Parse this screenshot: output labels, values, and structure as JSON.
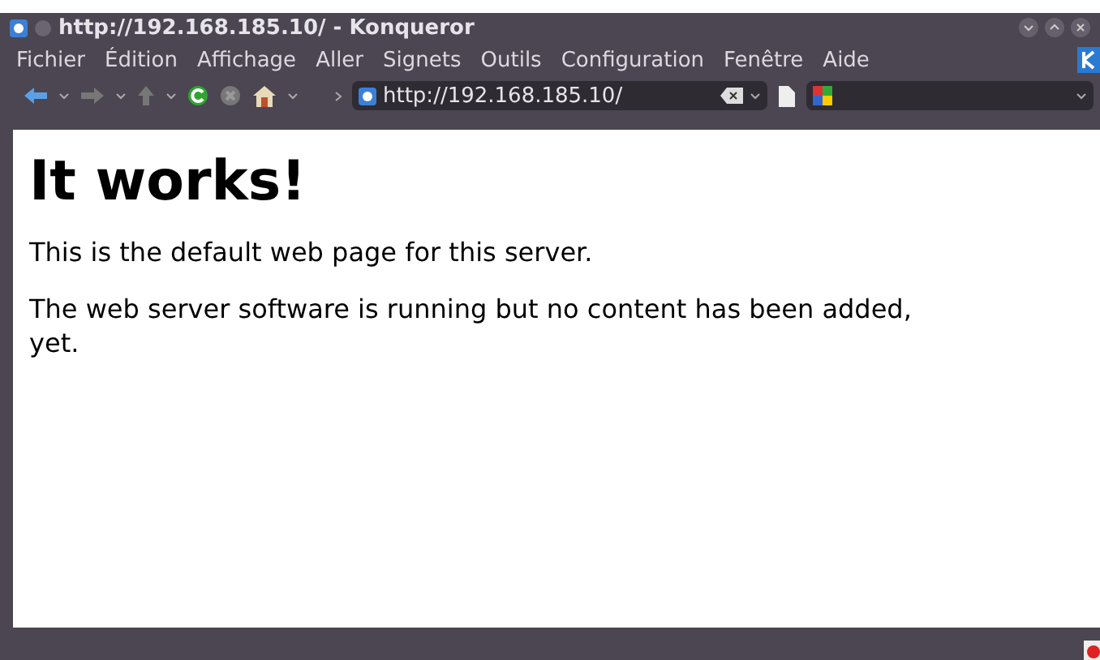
{
  "window": {
    "title": "http://192.168.185.10/ - Konqueror"
  },
  "menu": [
    "Fichier",
    "Édition",
    "Affichage",
    "Aller",
    "Signets",
    "Outils",
    "Configuration",
    "Fenêtre",
    "Aide"
  ],
  "address": {
    "value": "http://192.168.185.10/"
  },
  "page": {
    "heading": "It works!",
    "paragraphs": [
      "This is the default web page for this server.",
      "The web server software is running but no content has been added, yet."
    ]
  }
}
